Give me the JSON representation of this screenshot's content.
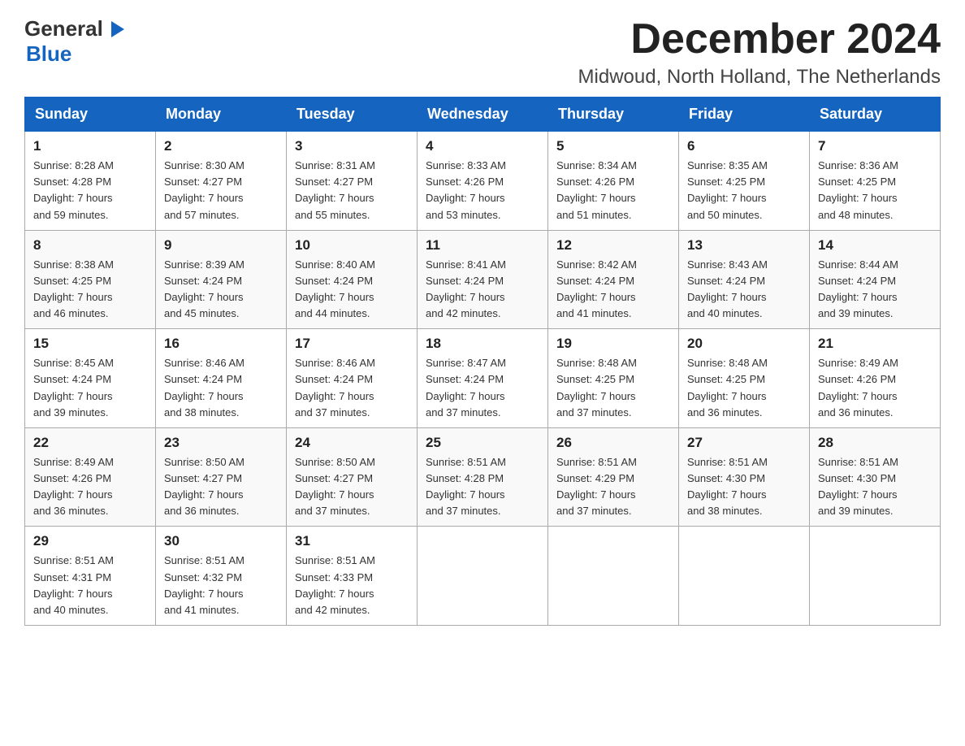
{
  "header": {
    "logo": {
      "general": "General",
      "arrow": "▶",
      "blue": "Blue"
    },
    "title": "December 2024",
    "location": "Midwoud, North Holland, The Netherlands"
  },
  "days_of_week": [
    "Sunday",
    "Monday",
    "Tuesday",
    "Wednesday",
    "Thursday",
    "Friday",
    "Saturday"
  ],
  "weeks": [
    [
      {
        "day": "1",
        "sunrise": "8:28 AM",
        "sunset": "4:28 PM",
        "daylight": "7 hours and 59 minutes."
      },
      {
        "day": "2",
        "sunrise": "8:30 AM",
        "sunset": "4:27 PM",
        "daylight": "7 hours and 57 minutes."
      },
      {
        "day": "3",
        "sunrise": "8:31 AM",
        "sunset": "4:27 PM",
        "daylight": "7 hours and 55 minutes."
      },
      {
        "day": "4",
        "sunrise": "8:33 AM",
        "sunset": "4:26 PM",
        "daylight": "7 hours and 53 minutes."
      },
      {
        "day": "5",
        "sunrise": "8:34 AM",
        "sunset": "4:26 PM",
        "daylight": "7 hours and 51 minutes."
      },
      {
        "day": "6",
        "sunrise": "8:35 AM",
        "sunset": "4:25 PM",
        "daylight": "7 hours and 50 minutes."
      },
      {
        "day": "7",
        "sunrise": "8:36 AM",
        "sunset": "4:25 PM",
        "daylight": "7 hours and 48 minutes."
      }
    ],
    [
      {
        "day": "8",
        "sunrise": "8:38 AM",
        "sunset": "4:25 PM",
        "daylight": "7 hours and 46 minutes."
      },
      {
        "day": "9",
        "sunrise": "8:39 AM",
        "sunset": "4:24 PM",
        "daylight": "7 hours and 45 minutes."
      },
      {
        "day": "10",
        "sunrise": "8:40 AM",
        "sunset": "4:24 PM",
        "daylight": "7 hours and 44 minutes."
      },
      {
        "day": "11",
        "sunrise": "8:41 AM",
        "sunset": "4:24 PM",
        "daylight": "7 hours and 42 minutes."
      },
      {
        "day": "12",
        "sunrise": "8:42 AM",
        "sunset": "4:24 PM",
        "daylight": "7 hours and 41 minutes."
      },
      {
        "day": "13",
        "sunrise": "8:43 AM",
        "sunset": "4:24 PM",
        "daylight": "7 hours and 40 minutes."
      },
      {
        "day": "14",
        "sunrise": "8:44 AM",
        "sunset": "4:24 PM",
        "daylight": "7 hours and 39 minutes."
      }
    ],
    [
      {
        "day": "15",
        "sunrise": "8:45 AM",
        "sunset": "4:24 PM",
        "daylight": "7 hours and 39 minutes."
      },
      {
        "day": "16",
        "sunrise": "8:46 AM",
        "sunset": "4:24 PM",
        "daylight": "7 hours and 38 minutes."
      },
      {
        "day": "17",
        "sunrise": "8:46 AM",
        "sunset": "4:24 PM",
        "daylight": "7 hours and 37 minutes."
      },
      {
        "day": "18",
        "sunrise": "8:47 AM",
        "sunset": "4:24 PM",
        "daylight": "7 hours and 37 minutes."
      },
      {
        "day": "19",
        "sunrise": "8:48 AM",
        "sunset": "4:25 PM",
        "daylight": "7 hours and 37 minutes."
      },
      {
        "day": "20",
        "sunrise": "8:48 AM",
        "sunset": "4:25 PM",
        "daylight": "7 hours and 36 minutes."
      },
      {
        "day": "21",
        "sunrise": "8:49 AM",
        "sunset": "4:26 PM",
        "daylight": "7 hours and 36 minutes."
      }
    ],
    [
      {
        "day": "22",
        "sunrise": "8:49 AM",
        "sunset": "4:26 PM",
        "daylight": "7 hours and 36 minutes."
      },
      {
        "day": "23",
        "sunrise": "8:50 AM",
        "sunset": "4:27 PM",
        "daylight": "7 hours and 36 minutes."
      },
      {
        "day": "24",
        "sunrise": "8:50 AM",
        "sunset": "4:27 PM",
        "daylight": "7 hours and 37 minutes."
      },
      {
        "day": "25",
        "sunrise": "8:51 AM",
        "sunset": "4:28 PM",
        "daylight": "7 hours and 37 minutes."
      },
      {
        "day": "26",
        "sunrise": "8:51 AM",
        "sunset": "4:29 PM",
        "daylight": "7 hours and 37 minutes."
      },
      {
        "day": "27",
        "sunrise": "8:51 AM",
        "sunset": "4:30 PM",
        "daylight": "7 hours and 38 minutes."
      },
      {
        "day": "28",
        "sunrise": "8:51 AM",
        "sunset": "4:30 PM",
        "daylight": "7 hours and 39 minutes."
      }
    ],
    [
      {
        "day": "29",
        "sunrise": "8:51 AM",
        "sunset": "4:31 PM",
        "daylight": "7 hours and 40 minutes."
      },
      {
        "day": "30",
        "sunrise": "8:51 AM",
        "sunset": "4:32 PM",
        "daylight": "7 hours and 41 minutes."
      },
      {
        "day": "31",
        "sunrise": "8:51 AM",
        "sunset": "4:33 PM",
        "daylight": "7 hours and 42 minutes."
      },
      null,
      null,
      null,
      null
    ]
  ],
  "labels": {
    "sunrise": "Sunrise:",
    "sunset": "Sunset:",
    "daylight": "Daylight:"
  }
}
